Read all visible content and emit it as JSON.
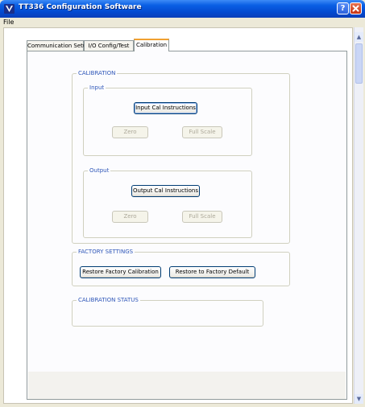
{
  "window": {
    "title": "TT336 Configuration Software",
    "help_label": "?"
  },
  "menu": {
    "file": "File"
  },
  "tabs": [
    {
      "label": "Communication Setup"
    },
    {
      "label": "I/O Config/Test"
    },
    {
      "label": "Calibration",
      "active": true
    }
  ],
  "calibration": {
    "group_label": "CALIBRATION",
    "input": {
      "label": "Input",
      "instructions": "Input Cal Instructions",
      "zero": "Zero",
      "full_scale": "Full Scale"
    },
    "output": {
      "label": "Output",
      "instructions": "Output Cal Instructions",
      "zero": "Zero",
      "full_scale": "Full Scale"
    }
  },
  "factory": {
    "group_label": "FACTORY SETTINGS",
    "restore_calibration": "Restore Factory Calibration",
    "restore_default": "Restore to Factory Default"
  },
  "status": {
    "group_label": "CALIBRATION STATUS"
  },
  "colors": {
    "titlebar": "#0a5fe4",
    "group_label": "#2e56b8",
    "active_tab_accent": "#f0a030"
  }
}
